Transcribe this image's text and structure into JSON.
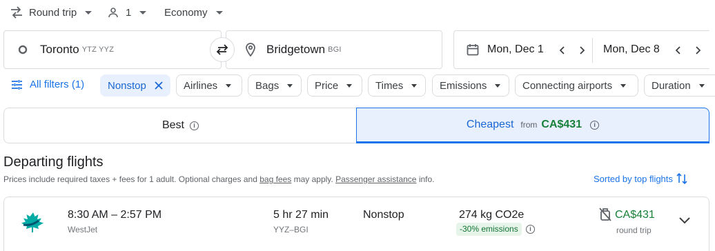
{
  "trip_selector": {
    "type": "Round trip",
    "passengers": "1",
    "cabin": "Economy"
  },
  "origin": {
    "city": "Toronto",
    "codes": "YTZ YYZ"
  },
  "destination": {
    "city": "Bridgetown",
    "code": "BGI"
  },
  "dates": {
    "depart": "Mon, Dec 1",
    "return": "Mon, Dec 8"
  },
  "filters": {
    "all_filters": "All filters (1)",
    "chips": [
      "Nonstop",
      "Airlines",
      "Bags",
      "Price",
      "Times",
      "Emissions",
      "Connecting airports",
      "Duration"
    ]
  },
  "tabs": {
    "best": "Best",
    "cheapest": "Cheapest",
    "cheapest_from": "from",
    "cheapest_price": "CA$431"
  },
  "section": {
    "title": "Departing flights",
    "note_prefix": "Prices include required taxes + fees for 1 adult. Optional charges and ",
    "bag_fees": "bag fees",
    "note_mid": " may apply. ",
    "passenger_assistance": "Passenger assistance",
    "note_suffix": " info.",
    "sort_label": "Sorted by top flights"
  },
  "flights": [
    {
      "times": "8:30 AM – 2:57 PM",
      "airline": "WestJet",
      "duration": "5 hr 27 min",
      "route": "YYZ–BGI",
      "stops": "Nonstop",
      "emissions": "274 kg CO2e",
      "emissions_badge": "-30% emissions",
      "price": "CA$431",
      "price_type": "round trip"
    }
  ],
  "colors": {
    "accent": "#1a73e8",
    "price_green": "#188038",
    "active_chip_bg": "#e8f0fe",
    "badge_bg": "#e6f4ea"
  },
  "icons": [
    "swap-arrows-icon",
    "person-icon",
    "circle-origin-icon",
    "pin-icon",
    "swap-icon",
    "calendar-icon",
    "chevron-left-icon",
    "chevron-right-icon",
    "tune-icon",
    "close-icon",
    "info-icon",
    "sort-icon",
    "no-carry-on-bag-icon",
    "expand-icon",
    "westjet-logo"
  ]
}
